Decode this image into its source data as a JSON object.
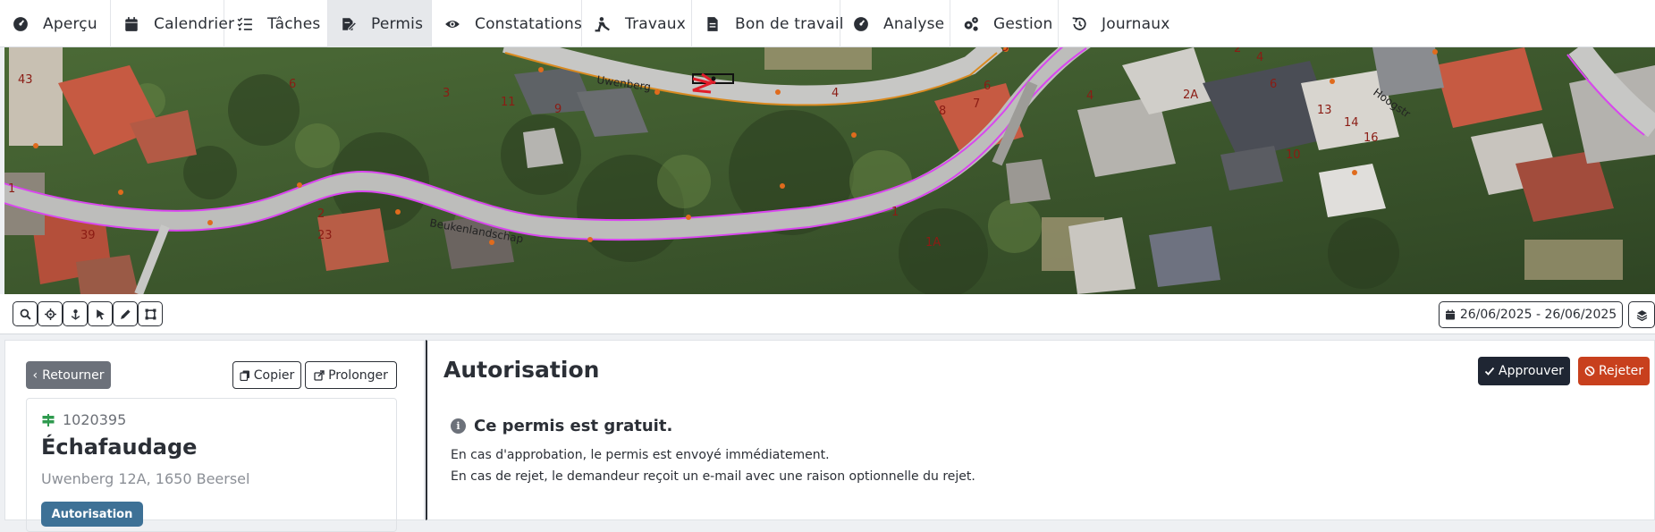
{
  "nav": {
    "items": [
      {
        "label": "Aperçu",
        "icon": "gauge-icon"
      },
      {
        "label": "Calendrier",
        "icon": "calendar-icon"
      },
      {
        "label": "Tâches",
        "icon": "tasks-icon"
      },
      {
        "label": "Permis",
        "icon": "permit-icon",
        "active": true
      },
      {
        "label": "Constatations",
        "icon": "eye-icon"
      },
      {
        "label": "Travaux",
        "icon": "worker-icon"
      },
      {
        "label": "Bon de travail",
        "icon": "document-icon"
      },
      {
        "label": "Analyse",
        "icon": "gauge-icon"
      },
      {
        "label": "Gestion",
        "icon": "gears-icon"
      },
      {
        "label": "Journaux",
        "icon": "history-icon"
      }
    ]
  },
  "map": {
    "streets": [
      "Uwenberg",
      "Beukenlandschap",
      "Hoogstr"
    ],
    "house_numbers": [
      "43",
      "6",
      "3",
      "11",
      "9",
      "4",
      "6",
      "8",
      "7",
      "4",
      "2A",
      "6",
      "13",
      "14",
      "16",
      "10",
      "4",
      "5",
      "3",
      "2",
      "39",
      "23",
      "2",
      "1",
      "1A",
      "1",
      "5"
    ]
  },
  "toolbar": {
    "date_range": "26/06/2025 - 26/06/2025"
  },
  "left": {
    "back_label": "Retourner",
    "copy_label": "Copier",
    "extend_label": "Prolonger",
    "permit": {
      "id": "1020395",
      "title": "Échafaudage",
      "address": "Uwenberg 12A, 1650 Beersel",
      "status": "Autorisation"
    }
  },
  "right": {
    "title": "Autorisation",
    "approve_label": "Approuver",
    "reject_label": "Rejeter",
    "info_title": "Ce permis est gratuit.",
    "info_lines": [
      "En cas d'approbation, le permis est envoyé immédiatement.",
      "En cas de rejet, le demandeur reçoit un e-mail avec une raison optionnelle du rejet."
    ]
  },
  "colors": {
    "approve": "#1f2633",
    "reject": "#c8401d",
    "status_badge": "#3e7196",
    "back_button": "#6c717a",
    "road_border": "#d946ef"
  }
}
